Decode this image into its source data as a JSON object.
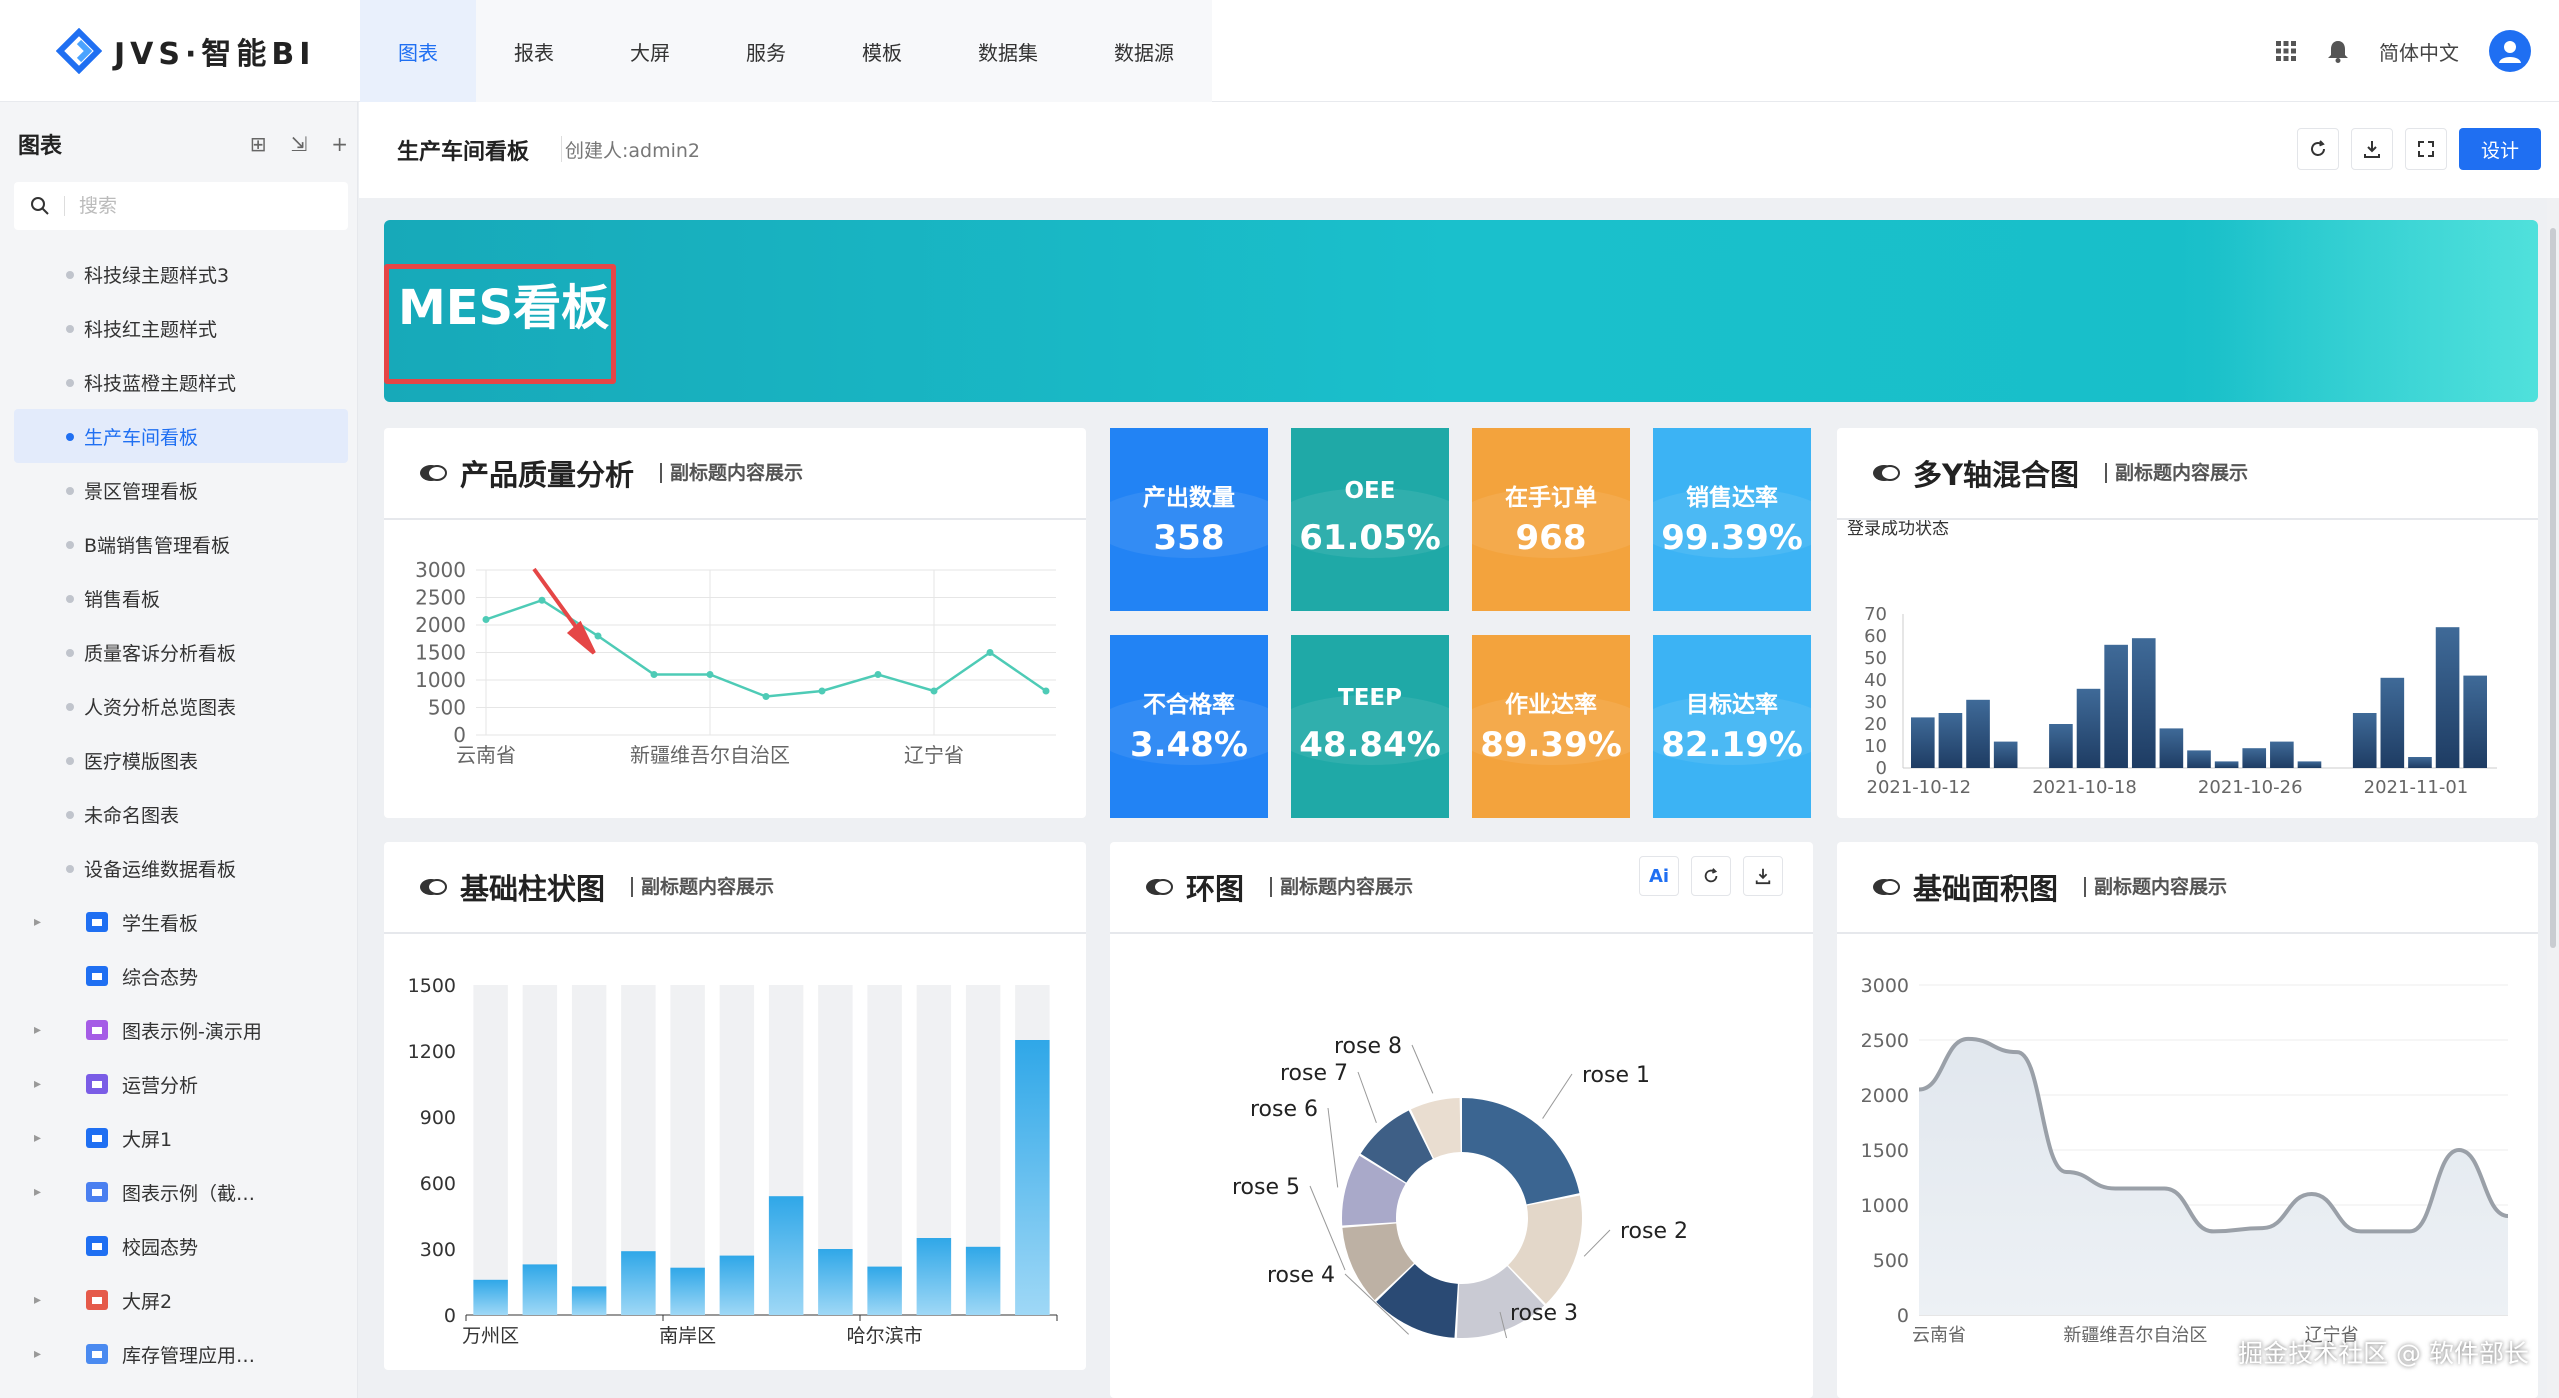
{
  "app": {
    "logo_text": "JVS·智能BI",
    "language": "简体中文"
  },
  "nav": {
    "items": [
      "图表",
      "报表",
      "大屏",
      "服务",
      "模板",
      "数据集",
      "数据源"
    ]
  },
  "sidebar": {
    "title": "图表",
    "search_placeholder": "搜索",
    "docs": [
      "科技绿主题样式3",
      "科技红主题样式",
      "科技蓝橙主题样式",
      "生产车间看板",
      "景区管理看板",
      "B端销售管理看板",
      "销售看板",
      "质量客诉分析看板",
      "人资分析总览图表",
      "医疗模版图表",
      "未命名图表",
      "设备运维数据看板"
    ],
    "folders": [
      {
        "label": "学生看板",
        "color": "#1f6ff2",
        "caret": true
      },
      {
        "label": "综合态势",
        "color": "#1f6ff2",
        "caret": false
      },
      {
        "label": "图表示例-演示用",
        "color": "#a55ce6",
        "caret": true
      },
      {
        "label": "运营分析",
        "color": "#7a5ce6",
        "caret": true
      },
      {
        "label": "大屏1",
        "color": "#1f6ff2",
        "caret": true
      },
      {
        "label": "图表示例（截…",
        "color": "#4a7ff0",
        "caret": true
      },
      {
        "label": "校园态势",
        "color": "#1f6ff2",
        "caret": false
      },
      {
        "label": "大屏2",
        "color": "#e55a4a",
        "caret": true
      },
      {
        "label": "库存管理应用…",
        "color": "#4a8af0",
        "caret": true
      }
    ]
  },
  "header": {
    "name": "生产车间看板",
    "creator": "创建人:admin2",
    "design_button": "设计"
  },
  "banner": {
    "title": "MES看板"
  },
  "kpis": [
    {
      "label": "产出数量",
      "value": "358",
      "color": "blue"
    },
    {
      "label": "OEE",
      "value": "61.05%",
      "color": "teal"
    },
    {
      "label": "在手订单",
      "value": "968",
      "color": "orange"
    },
    {
      "label": "销售达率",
      "value": "99.39%",
      "color": "sky"
    },
    {
      "label": "不合格率",
      "value": "3.48%",
      "color": "blue"
    },
    {
      "label": "TEEP",
      "value": "48.84%",
      "color": "teal"
    },
    {
      "label": "作业达率",
      "value": "89.39%",
      "color": "orange"
    },
    {
      "label": "目标达率",
      "value": "82.19%",
      "color": "sky"
    }
  ],
  "cards": {
    "quality": {
      "title": "产品质量分析",
      "subtitle": "副标题内容展示"
    },
    "multi": {
      "title": "多Y轴混合图",
      "subtitle": "副标题内容展示"
    },
    "bar": {
      "title": "基础柱状图",
      "subtitle": "副标题内容展示"
    },
    "ring": {
      "title": "环图",
      "subtitle": "副标题内容展示",
      "ai_label": "Ai"
    },
    "area": {
      "title": "基础面积图",
      "subtitle": "副标题内容展示"
    }
  },
  "watermark": "掘金技术社区 @ 软件部长",
  "chart_data": [
    {
      "id": "quality",
      "type": "line",
      "title": "产品质量分析",
      "x": [
        "云南省",
        "",
        "",
        "",
        "新疆维吾尔自治区",
        "",
        "",
        "",
        "辽宁省",
        "",
        ""
      ],
      "tick_labels": [
        "云南省",
        "新疆维吾尔自治区",
        "辽宁省"
      ],
      "values": [
        2100,
        2450,
        1800,
        1100,
        1100,
        700,
        800,
        1100,
        800,
        1500,
        800
      ],
      "ylim": [
        0,
        3000
      ],
      "yticks": [
        3000,
        2500,
        2000,
        1500,
        1000,
        500,
        0
      ],
      "color": "#4ecbb6"
    },
    {
      "id": "multi",
      "type": "bar",
      "title": "多Y轴混合图",
      "ylabel": "登录成功状态",
      "values": [
        23,
        25,
        31,
        12,
        0,
        20,
        36,
        56,
        59,
        18,
        8,
        3,
        9,
        12,
        3,
        0,
        25,
        41,
        5,
        64,
        42
      ],
      "ylim": [
        0,
        70
      ],
      "yticks": [
        70,
        60,
        50,
        40,
        30,
        20,
        10,
        0
      ],
      "tick_labels": [
        "2021-10-12",
        "2021-10-18",
        "2021-10-26",
        "2021-11-01"
      ]
    },
    {
      "id": "bar",
      "type": "bar",
      "title": "基础柱状图",
      "values": [
        160,
        230,
        130,
        290,
        215,
        270,
        540,
        300,
        220,
        350,
        310,
        1250
      ],
      "bg_max": 1500,
      "ylim": [
        0,
        1500
      ],
      "yticks": [
        1500,
        1200,
        900,
        600,
        300,
        0
      ],
      "tick_labels": [
        "万州区",
        "南岸区",
        "哈尔滨市"
      ]
    },
    {
      "id": "ring",
      "type": "pie",
      "title": "环图",
      "categories": [
        "rose 1",
        "rose 2",
        "rose 3",
        "rose 4",
        "rose 5",
        "rose 6",
        "rose 7",
        "rose 8"
      ],
      "values": [
        22,
        16,
        13,
        12,
        11,
        10,
        9,
        7
      ],
      "colors": [
        "#3b6591",
        "#e3d7c9",
        "#c9cad3",
        "#2a4a74",
        "#bdb1a4",
        "#a9a9c9",
        "#3e5f86",
        "#e9ddd0"
      ]
    },
    {
      "id": "area",
      "type": "area",
      "title": "基础面积图",
      "values": [
        2050,
        2510,
        2390,
        1300,
        1150,
        1150,
        760,
        790,
        1100,
        760,
        760,
        1500,
        900
      ],
      "ylim": [
        0,
        3000
      ],
      "yticks": [
        3000,
        2500,
        2000,
        1500,
        1000,
        500,
        0
      ],
      "tick_labels": [
        "云南省",
        "新疆维吾尔自治区",
        "辽宁省"
      ]
    }
  ]
}
